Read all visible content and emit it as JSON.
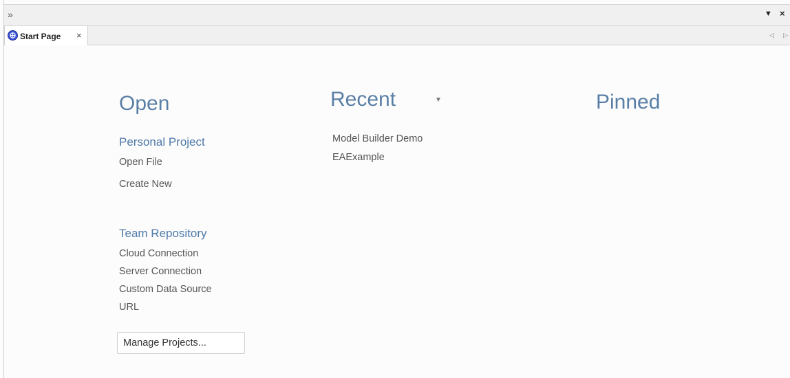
{
  "window": {
    "expand_icon": "double-chevron-right-icon",
    "menu_icon": "dropdown-arrow-icon",
    "close_icon": "close-icon"
  },
  "tab": {
    "label": "Start Page",
    "icon": "ea-logo-icon",
    "close": "×"
  },
  "open": {
    "heading": "Open",
    "personal_heading": "Personal Project",
    "personal_items": [
      "Open File",
      "Create New"
    ],
    "team_heading": "Team Repository",
    "team_items": [
      "Cloud Connection",
      "Server Connection",
      "Custom Data Source",
      "URL"
    ],
    "manage_button": "Manage Projects..."
  },
  "recent": {
    "heading": "Recent",
    "items": [
      "Model Builder Demo",
      "EAExample"
    ]
  },
  "pinned": {
    "heading": "Pinned"
  }
}
